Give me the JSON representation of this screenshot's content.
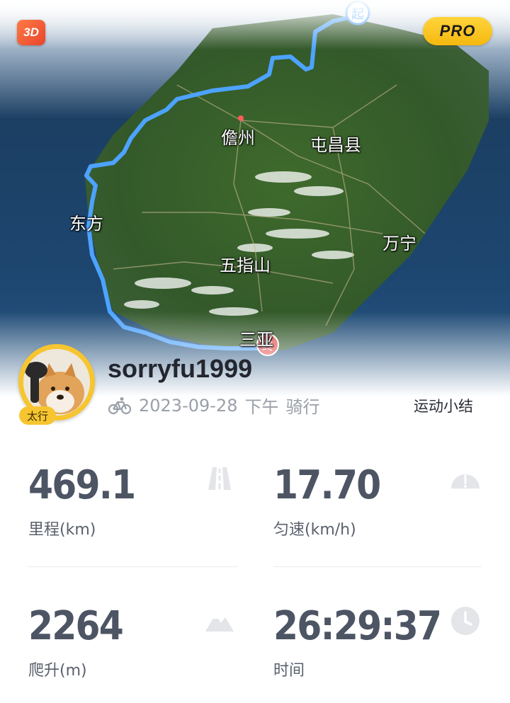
{
  "map": {
    "badge_3d": "3D",
    "badge_pro": "PRO",
    "start_marker": "起",
    "end_marker": "终",
    "places": [
      "儋州",
      "屯昌县",
      "东方",
      "万宁",
      "五指山",
      "三亚"
    ],
    "route_color": "#4da3ff"
  },
  "user": {
    "name": "sorryfu1999",
    "avatar_tag": "太行",
    "date": "2023-09-28",
    "time_of_day": "下午",
    "activity": "骑行"
  },
  "summary_link": "运动小结",
  "stats": [
    {
      "value": "469.1",
      "label": "里程(km)",
      "icon": "road-icon"
    },
    {
      "value": "17.70",
      "label": "匀速(km/h)",
      "icon": "speedometer-icon"
    },
    {
      "value": "2264",
      "label": "爬升(m)",
      "icon": "mountain-icon"
    },
    {
      "value": "26:29:37",
      "label": "时间",
      "icon": "clock-icon"
    }
  ]
}
